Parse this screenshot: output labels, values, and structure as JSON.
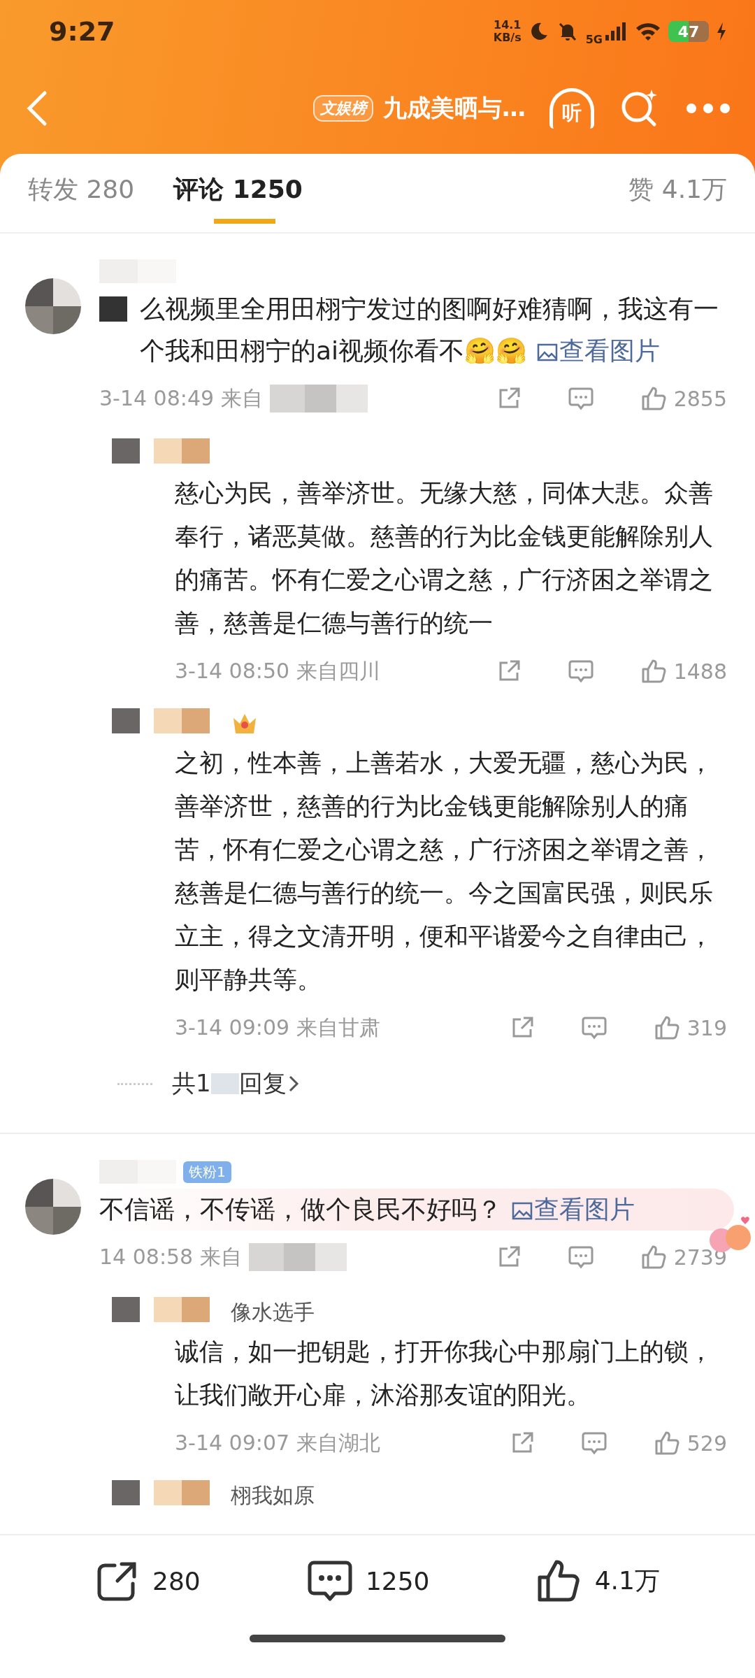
{
  "status_bar": {
    "time": "9:27",
    "net_speed": "14.1",
    "net_unit": "KB/s",
    "network": "5G",
    "battery": "47"
  },
  "header": {
    "badge": "文娱榜",
    "title": "九成美晒与…",
    "listen_label": "听"
  },
  "tabs": [
    {
      "label": "转发 280",
      "selected": false
    },
    {
      "label": "评论 1250",
      "selected": true
    },
    {
      "label": "赞 4.1万",
      "selected": false
    }
  ],
  "comments": [
    {
      "kind": "comment",
      "text": "么视频里全用田栩宁发过的图啊好难猜啊，我这有一个我和田栩宁的ai视频你看不🤗🤗",
      "link": "查看图片",
      "time": "3-14 08:49",
      "location": "来自",
      "likes": "2855",
      "highlighted": false
    },
    {
      "kind": "reply",
      "text": "慈心为民，善举济世。无缘大慈，同体大悲。众善奉行，诸恶莫做。慈善的行为比金钱更能解除别人的痛苦。怀有仁爱之心谓之慈，广行济困之举谓之善，慈善是仁德与善行的统一",
      "time": "3-14 08:50",
      "location": "来自四川",
      "likes": "1488"
    },
    {
      "kind": "reply",
      "crown": true,
      "text": "之初，性本善，上善若水，大爱无疆，慈心为民，善举济世，慈善的行为比金钱更能解除别人的痛苦，怀有仁爱之心谓之慈，广行济困之举谓之善，慈善是仁德与善行的统一。今之国富民强，则民乐立主，得之文清开明，便和平谐爱今之自律由己，则平静共等。",
      "time": "3-14 09:09",
      "location": "来自甘肃",
      "likes": "319"
    },
    {
      "kind": "more",
      "prefix": "共1",
      "suffix": "回复"
    },
    {
      "kind": "comment",
      "badge": "铁粉1",
      "text": "不信谣，不传谣，做个良民不好吗？",
      "link": "查看图片",
      "time": "14 08:58",
      "location": "来自",
      "likes": "2739",
      "highlighted": true
    },
    {
      "kind": "reply",
      "name": "像水选手",
      "text": "诚信，如一把钥匙，打开你我心中那扇门上的锁，让我们敞开心扉，沐浴那友谊的阳光。",
      "time": "3-14 09:07",
      "location": "来自湖北",
      "likes": "529"
    },
    {
      "kind": "reply",
      "name": "栩我如原"
    }
  ],
  "bottom_bar": {
    "reposts": "280",
    "comments": "1250",
    "likes": "4.1万"
  }
}
